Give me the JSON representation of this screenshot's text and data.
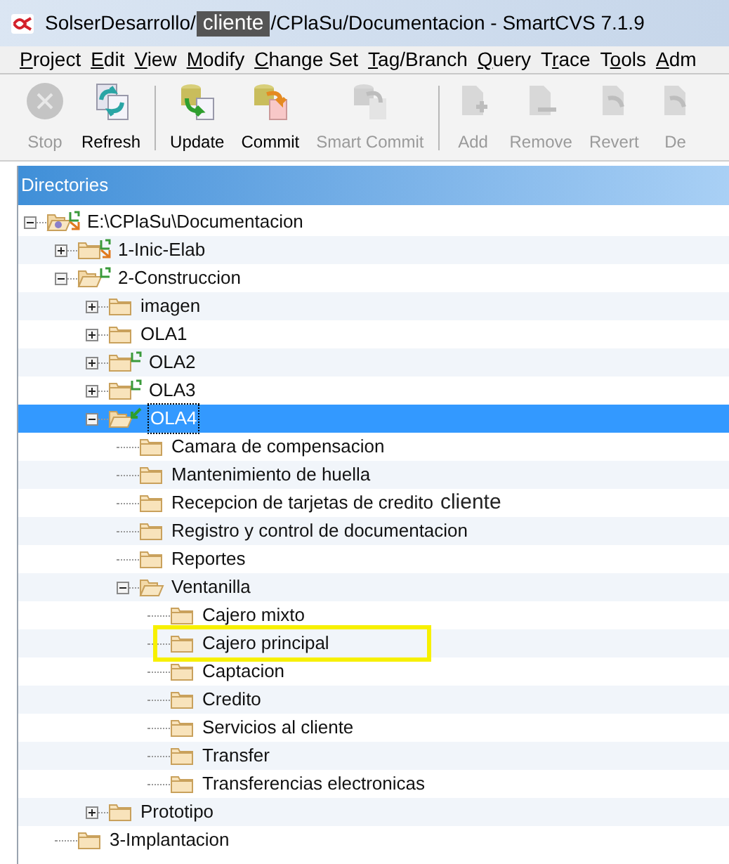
{
  "window": {
    "title_before": "SolserDesarrollo/",
    "title_redaction": "cliente",
    "title_after": "/CPlaSu/Documentacion - SmartCVS 7.1.9"
  },
  "menu": [
    {
      "key": "P",
      "after": "roject"
    },
    {
      "key": "E",
      "after": "dit"
    },
    {
      "key": "V",
      "after": "iew"
    },
    {
      "key": "M",
      "after": "odify"
    },
    {
      "key": "C",
      "after": "hange Set"
    },
    {
      "key": "T",
      "after": "ag/Branch"
    },
    {
      "key": "Q",
      "after": "uery"
    },
    {
      "before": "T",
      "key": "r",
      "after": "ace"
    },
    {
      "before": "T",
      "key": "o",
      "after": "ols"
    },
    {
      "key": "A",
      "after": "dm"
    }
  ],
  "toolbar": [
    {
      "kind": "stop",
      "label": "Stop",
      "disabled": true,
      "separator_after": false
    },
    {
      "kind": "refresh",
      "label": "Refresh",
      "disabled": false,
      "separator_after": true
    },
    {
      "kind": "update",
      "label": "Update",
      "disabled": false,
      "separator_after": false
    },
    {
      "kind": "commit",
      "label": "Commit",
      "disabled": false,
      "separator_after": false
    },
    {
      "kind": "smart",
      "label": "Smart Commit",
      "disabled": true,
      "separator_after": true
    },
    {
      "kind": "add",
      "label": "Add",
      "disabled": true,
      "separator_after": false
    },
    {
      "kind": "remove",
      "label": "Remove",
      "disabled": true,
      "separator_after": false
    },
    {
      "kind": "revert",
      "label": "Revert",
      "disabled": true,
      "separator_after": false
    },
    {
      "kind": "revert",
      "label": "De",
      "disabled": true,
      "separator_after": false
    }
  ],
  "panel": {
    "title": "Directories"
  },
  "tree": [
    {
      "label": "E:\\CPlaSu\\Documentacion",
      "kind": "root",
      "badge": {
        "kind": "mixed"
      },
      "expanded": true,
      "selected": false,
      "children": [
        {
          "label": "1-Inic-Elab",
          "badge": {
            "kind": "mixed"
          },
          "expanded": false,
          "selected": false
        },
        {
          "label": "2-Construccion",
          "badge": {
            "kind": "green"
          },
          "expanded": true,
          "selected": false,
          "children": [
            {
              "label": "imagen",
              "expanded": false,
              "selected": false
            },
            {
              "label": "OLA1",
              "expanded": false,
              "selected": false
            },
            {
              "label": "OLA2",
              "badge": {
                "kind": "green"
              },
              "expanded": false,
              "selected": false
            },
            {
              "label": "OLA3",
              "badge": {
                "kind": "green"
              },
              "expanded": false,
              "selected": false
            },
            {
              "label": "OLA4",
              "badge": {
                "kind": "arrow"
              },
              "expanded": true,
              "selected": true,
              "children": [
                {
                  "label": "Camara de compensacion",
                  "selected": false
                },
                {
                  "label": "Mantenimiento de huella",
                  "selected": false
                },
                {
                  "label": "Recepcion de tarjetas de credito",
                  "note": "cliente",
                  "selected": false
                },
                {
                  "label": "Registro y control de documentacion",
                  "selected": false
                },
                {
                  "label": "Reportes",
                  "selected": false
                },
                {
                  "label": "Ventanilla",
                  "expanded": true,
                  "selected": false,
                  "children": [
                    {
                      "label": "Cajero mixto",
                      "selected": false
                    },
                    {
                      "label": "Cajero principal",
                      "highlighted": true,
                      "selected": false
                    },
                    {
                      "label": "Captacion",
                      "selected": false
                    },
                    {
                      "label": "Credito",
                      "selected": false
                    },
                    {
                      "label": "Servicios al cliente",
                      "selected": false
                    },
                    {
                      "label": "Transfer",
                      "selected": false
                    },
                    {
                      "label": "Transferencias electronicas",
                      "selected": false
                    }
                  ]
                }
              ]
            },
            {
              "label": "Prototipo",
              "expanded": false,
              "selected": false
            }
          ]
        },
        {
          "label": "3-Implantacion",
          "selected": false
        }
      ]
    }
  ]
}
